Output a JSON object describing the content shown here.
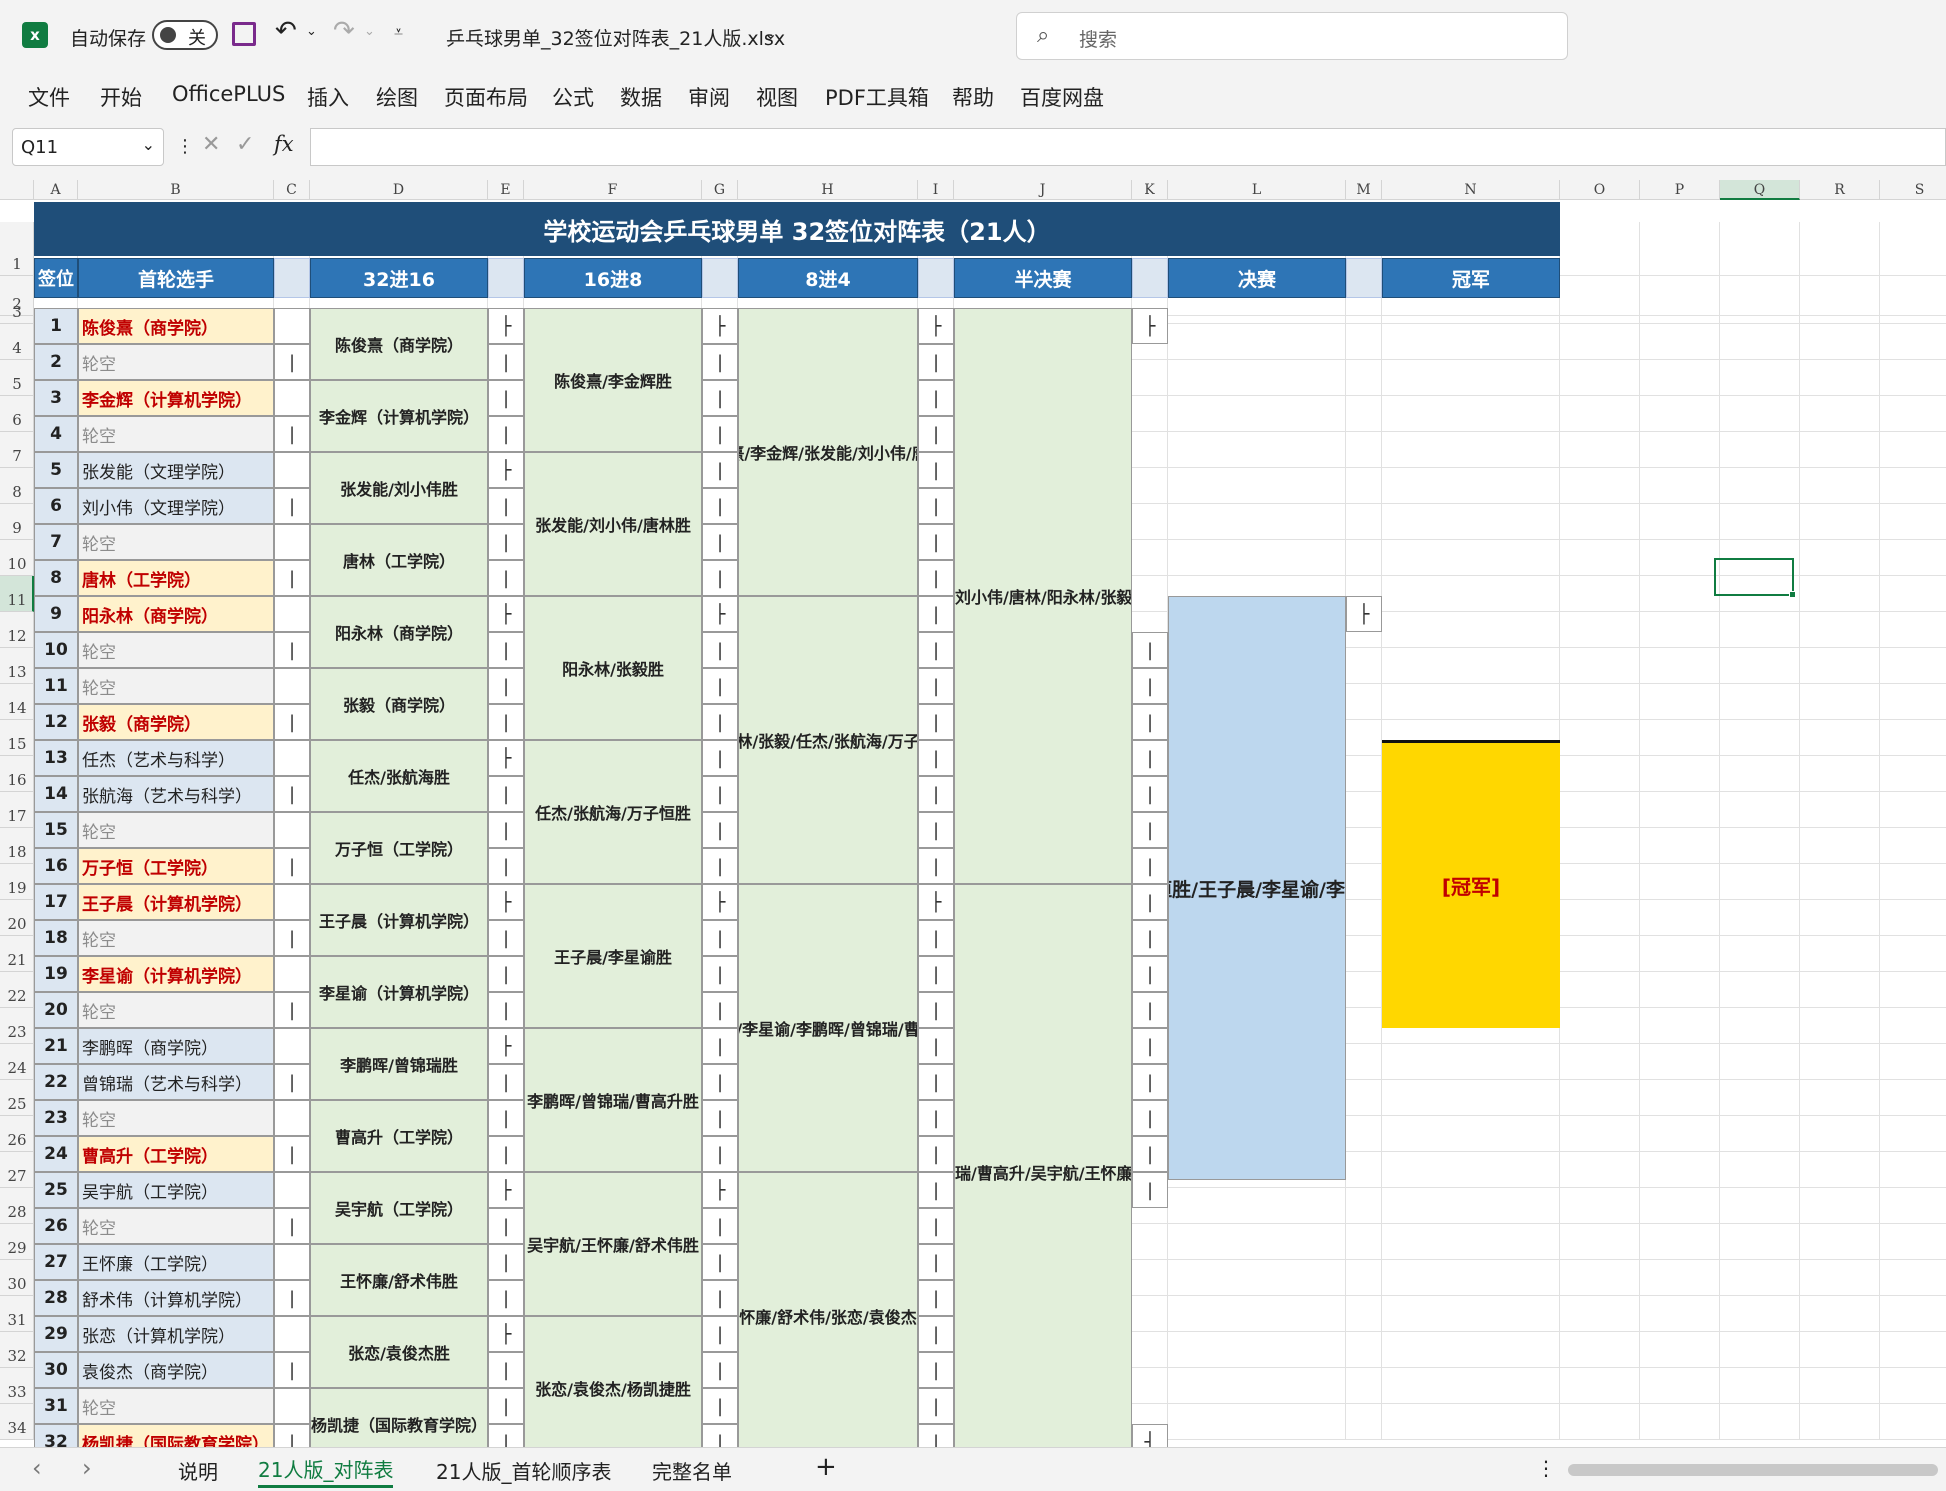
{
  "window": {
    "autosave_label": "自动保存",
    "autosave_state": "关",
    "filename": "乒乓球男单_32签位对阵表_21人版.xlsx",
    "search_placeholder": "搜索"
  },
  "ribbon": {
    "tabs": [
      "文件",
      "开始",
      "OfficePLUS",
      "插入",
      "绘图",
      "页面布局",
      "公式",
      "数据",
      "审阅",
      "视图",
      "PDF工具箱",
      "帮助",
      "百度网盘"
    ]
  },
  "formula_bar": {
    "name_box": "Q11",
    "fx_label": "fx",
    "formula": ""
  },
  "columns": [
    "A",
    "B",
    "C",
    "D",
    "E",
    "F",
    "G",
    "H",
    "I",
    "J",
    "K",
    "L",
    "M",
    "N",
    "O",
    "P",
    "Q",
    "R",
    "S"
  ],
  "sheet": {
    "title": "学校运动会乒乓球男单 32签位对阵表（21人）",
    "headers": {
      "seed": "签位",
      "first_round": "首轮选手",
      "r32": "32进16",
      "r16": "16进8",
      "qf": "8进4",
      "sf": "半决赛",
      "final": "决赛",
      "champion": "冠军"
    },
    "players": [
      {
        "seed": "1",
        "name": "陈俊熹（商学院）",
        "kind": "red"
      },
      {
        "seed": "2",
        "name": "轮空",
        "kind": "grey"
      },
      {
        "seed": "3",
        "name": "李金辉（计算机学院）",
        "kind": "red"
      },
      {
        "seed": "4",
        "name": "轮空",
        "kind": "grey"
      },
      {
        "seed": "5",
        "name": "张发能（文理学院）",
        "kind": "blue"
      },
      {
        "seed": "6",
        "name": "刘小伟（文理学院）",
        "kind": "blue"
      },
      {
        "seed": "7",
        "name": "轮空",
        "kind": "grey"
      },
      {
        "seed": "8",
        "name": "唐林（工学院）",
        "kind": "red"
      },
      {
        "seed": "9",
        "name": "阳永林（商学院）",
        "kind": "red"
      },
      {
        "seed": "10",
        "name": "轮空",
        "kind": "grey"
      },
      {
        "seed": "11",
        "name": "轮空",
        "kind": "grey"
      },
      {
        "seed": "12",
        "name": "张毅（商学院）",
        "kind": "red"
      },
      {
        "seed": "13",
        "name": "任杰（艺术与科学）",
        "kind": "blue"
      },
      {
        "seed": "14",
        "name": "张航海（艺术与科学）",
        "kind": "blue"
      },
      {
        "seed": "15",
        "name": "轮空",
        "kind": "grey"
      },
      {
        "seed": "16",
        "name": "万子恒（工学院）",
        "kind": "red"
      },
      {
        "seed": "17",
        "name": "王子晨（计算机学院）",
        "kind": "red"
      },
      {
        "seed": "18",
        "name": "轮空",
        "kind": "grey"
      },
      {
        "seed": "19",
        "name": "李星谕（计算机学院）",
        "kind": "red"
      },
      {
        "seed": "20",
        "name": "轮空",
        "kind": "grey"
      },
      {
        "seed": "21",
        "name": "李鹏晖（商学院）",
        "kind": "blue"
      },
      {
        "seed": "22",
        "name": "曾锦瑞（艺术与科学）",
        "kind": "blue"
      },
      {
        "seed": "23",
        "name": "轮空",
        "kind": "grey"
      },
      {
        "seed": "24",
        "name": "曹高升（工学院）",
        "kind": "red"
      },
      {
        "seed": "25",
        "name": "吴宇航（工学院）",
        "kind": "blue"
      },
      {
        "seed": "26",
        "name": "轮空",
        "kind": "grey"
      },
      {
        "seed": "27",
        "name": "王怀廉（工学院）",
        "kind": "blue"
      },
      {
        "seed": "28",
        "name": "舒术伟（计算机学院）",
        "kind": "blue"
      },
      {
        "seed": "29",
        "name": "张恋（计算机学院）",
        "kind": "blue"
      },
      {
        "seed": "30",
        "name": "袁俊杰（商学院）",
        "kind": "blue"
      },
      {
        "seed": "31",
        "name": "轮空",
        "kind": "grey"
      },
      {
        "seed": "32",
        "name": "杨凯捷（国际教育学院）",
        "kind": "red"
      }
    ],
    "r32": [
      "陈俊熹（商学院）",
      "李金辉（计算机学院）",
      "张发能/刘小伟胜",
      "唐林（工学院）",
      "阳永林（商学院）",
      "张毅（商学院）",
      "任杰/张航海胜",
      "万子恒（工学院）",
      "王子晨（计算机学院）",
      "李星谕（计算机学院）",
      "李鹏晖/曾锦瑞胜",
      "曹高升（工学院）",
      "吴宇航（工学院）",
      "王怀廉/舒术伟胜",
      "张恋/袁俊杰胜",
      "杨凯捷（国际教育学院）"
    ],
    "r16": [
      "陈俊熹/李金辉胜",
      "张发能/刘小伟/唐林胜",
      "阳永林/张毅胜",
      "任杰/张航海/万子恒胜",
      "王子晨/李星谕胜",
      "李鹏晖/曾锦瑞/曹高升胜",
      "吴宇航/王怀廉/舒术伟胜",
      "张恋/袁俊杰/杨凯捷胜"
    ],
    "qf": [
      "熹/李金辉/张发能/刘小伟/唐",
      "林/张毅/任杰/张航海/万子",
      "/李星谕/李鹏晖/曾锦瑞/曹",
      "怀廉/舒术伟/张恋/袁俊杰"
    ],
    "sf": [
      "刘小伟/唐林/阳永林/张毅/",
      "瑞/曹高升/吴宇航/王怀廉/舒"
    ],
    "final": "恒胜/王子晨/李星谕/李",
    "champion": "[冠军]",
    "tick_mark": "|",
    "tick_top": "├",
    "tick_bottom": "┤"
  },
  "sheet_tabs": [
    "说明",
    "21人版_对阵表",
    "21人版_首轮顺序表",
    "完整名单"
  ],
  "add_sheet": "+",
  "nav_prev": "‹",
  "nav_next": "›",
  "more": "⋮"
}
